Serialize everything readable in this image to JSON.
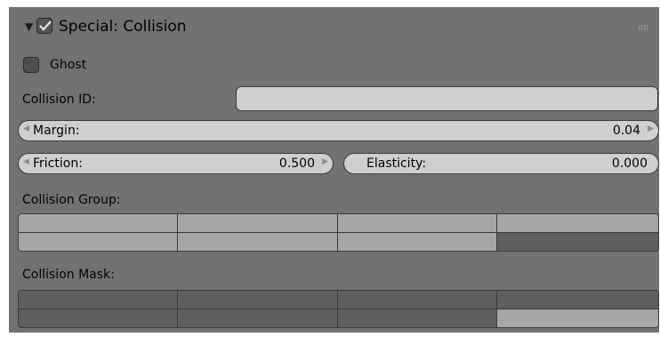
{
  "panel": {
    "title": "Special: Collision",
    "enabled": true,
    "ghost_label": "Ghost",
    "ghost_checked": false,
    "collision_id_label": "Collision ID:",
    "collision_id_value": "",
    "margin_label": "Margin:",
    "margin_value": "0.04",
    "friction_label": "Friction:",
    "friction_value": "0.500",
    "elasticity_label": "Elasticity:",
    "elasticity_value": "0.000",
    "collision_group_label": "Collision Group:",
    "collision_mask_label": "Collision Mask:"
  },
  "colors": {
    "panel_bg": "#727272",
    "field_bg": "#cfcfcf",
    "layer_on": "#a6a6a6",
    "layer_off": "#5f5f5f"
  },
  "layers": {
    "group": [
      [
        true,
        true,
        true,
        true
      ],
      [
        true,
        true,
        true,
        false
      ]
    ],
    "mask": [
      [
        false,
        false,
        false,
        false
      ],
      [
        false,
        false,
        false,
        true
      ]
    ]
  }
}
